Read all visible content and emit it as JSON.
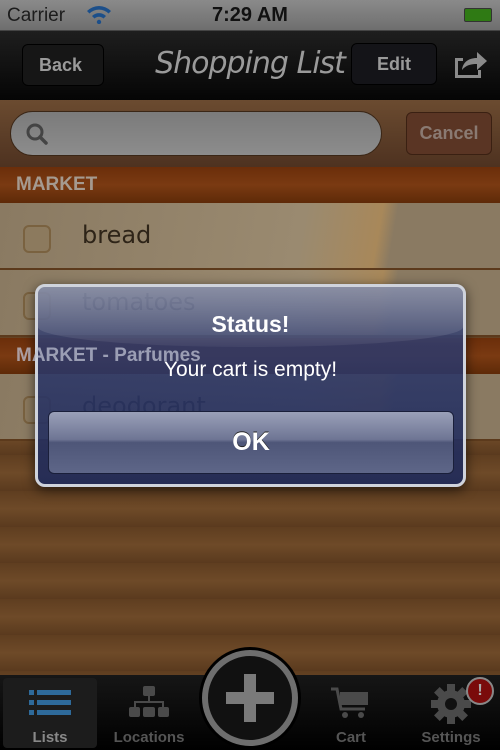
{
  "status_bar": {
    "carrier": "Carrier",
    "time": "7:29 AM",
    "wifi_icon": "wifi-icon",
    "battery_icon": "battery-icon"
  },
  "nav": {
    "back_label": "Back",
    "title": "Shopping List",
    "edit_label": "Edit",
    "share_icon": "share-icon"
  },
  "search": {
    "placeholder": "",
    "value": "",
    "cancel_label": "Cancel"
  },
  "sections": [
    {
      "title": "MARKET",
      "items": [
        {
          "name": "bread",
          "checked": false
        },
        {
          "name": "tomatoes",
          "checked": false
        }
      ]
    },
    {
      "title": "MARKET - Parfumes",
      "items": [
        {
          "name": "deodorant",
          "checked": false
        }
      ]
    }
  ],
  "tabbar": {
    "tabs": [
      {
        "label": "Lists",
        "icon": "list-icon",
        "selected": true
      },
      {
        "label": "Locations",
        "icon": "hierarchy-icon"
      },
      {
        "label": "Cart",
        "icon": "cart-icon"
      },
      {
        "label": "Settings",
        "icon": "gear-icon"
      }
    ],
    "add_icon": "plus-icon",
    "settings_badge": "!"
  },
  "alert": {
    "title": "Status!",
    "message": "Your cart is empty!",
    "ok_label": "OK"
  },
  "colors": {
    "alert_bg": "#1f2a5a",
    "section_bg": "#6b2e0a",
    "badge": "#7a0b0b"
  }
}
